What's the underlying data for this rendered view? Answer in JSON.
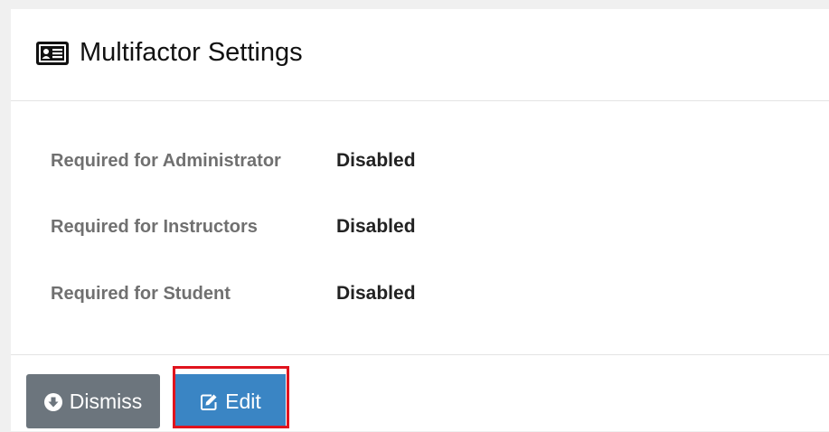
{
  "card": {
    "title": "Multifactor Settings",
    "title_icon": "id-card-icon"
  },
  "settings": [
    {
      "label": "Required for Administrator",
      "value": "Disabled"
    },
    {
      "label": "Required for Instructors",
      "value": "Disabled"
    },
    {
      "label": "Required for Student",
      "value": "Disabled"
    }
  ],
  "footer": {
    "dismiss_label": "Dismiss",
    "dismiss_icon": "arrow-circle-down-icon",
    "edit_label": "Edit",
    "edit_icon": "edit-icon"
  },
  "colors": {
    "dismiss_bg": "#6c757d",
    "edit_bg": "#3a85c4",
    "highlight_border": "#e0141e"
  }
}
